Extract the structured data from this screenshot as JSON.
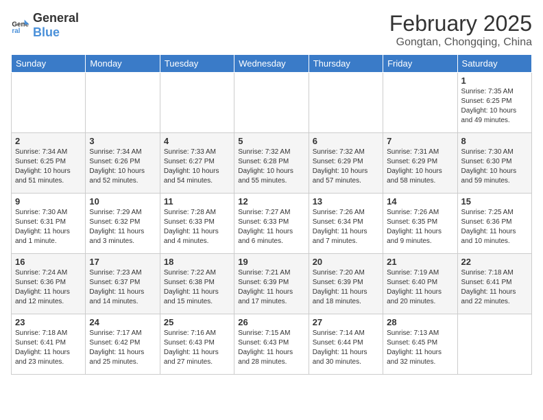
{
  "header": {
    "logo_general": "General",
    "logo_blue": "Blue",
    "month": "February 2025",
    "location": "Gongtan, Chongqing, China"
  },
  "weekdays": [
    "Sunday",
    "Monday",
    "Tuesday",
    "Wednesday",
    "Thursday",
    "Friday",
    "Saturday"
  ],
  "weeks": [
    [
      {
        "day": "",
        "info": ""
      },
      {
        "day": "",
        "info": ""
      },
      {
        "day": "",
        "info": ""
      },
      {
        "day": "",
        "info": ""
      },
      {
        "day": "",
        "info": ""
      },
      {
        "day": "",
        "info": ""
      },
      {
        "day": "1",
        "info": "Sunrise: 7:35 AM\nSunset: 6:25 PM\nDaylight: 10 hours\nand 49 minutes."
      }
    ],
    [
      {
        "day": "2",
        "info": "Sunrise: 7:34 AM\nSunset: 6:25 PM\nDaylight: 10 hours\nand 51 minutes."
      },
      {
        "day": "3",
        "info": "Sunrise: 7:34 AM\nSunset: 6:26 PM\nDaylight: 10 hours\nand 52 minutes."
      },
      {
        "day": "4",
        "info": "Sunrise: 7:33 AM\nSunset: 6:27 PM\nDaylight: 10 hours\nand 54 minutes."
      },
      {
        "day": "5",
        "info": "Sunrise: 7:32 AM\nSunset: 6:28 PM\nDaylight: 10 hours\nand 55 minutes."
      },
      {
        "day": "6",
        "info": "Sunrise: 7:32 AM\nSunset: 6:29 PM\nDaylight: 10 hours\nand 57 minutes."
      },
      {
        "day": "7",
        "info": "Sunrise: 7:31 AM\nSunset: 6:29 PM\nDaylight: 10 hours\nand 58 minutes."
      },
      {
        "day": "8",
        "info": "Sunrise: 7:30 AM\nSunset: 6:30 PM\nDaylight: 10 hours\nand 59 minutes."
      }
    ],
    [
      {
        "day": "9",
        "info": "Sunrise: 7:30 AM\nSunset: 6:31 PM\nDaylight: 11 hours\nand 1 minute."
      },
      {
        "day": "10",
        "info": "Sunrise: 7:29 AM\nSunset: 6:32 PM\nDaylight: 11 hours\nand 3 minutes."
      },
      {
        "day": "11",
        "info": "Sunrise: 7:28 AM\nSunset: 6:33 PM\nDaylight: 11 hours\nand 4 minutes."
      },
      {
        "day": "12",
        "info": "Sunrise: 7:27 AM\nSunset: 6:33 PM\nDaylight: 11 hours\nand 6 minutes."
      },
      {
        "day": "13",
        "info": "Sunrise: 7:26 AM\nSunset: 6:34 PM\nDaylight: 11 hours\nand 7 minutes."
      },
      {
        "day": "14",
        "info": "Sunrise: 7:26 AM\nSunset: 6:35 PM\nDaylight: 11 hours\nand 9 minutes."
      },
      {
        "day": "15",
        "info": "Sunrise: 7:25 AM\nSunset: 6:36 PM\nDaylight: 11 hours\nand 10 minutes."
      }
    ],
    [
      {
        "day": "16",
        "info": "Sunrise: 7:24 AM\nSunset: 6:36 PM\nDaylight: 11 hours\nand 12 minutes."
      },
      {
        "day": "17",
        "info": "Sunrise: 7:23 AM\nSunset: 6:37 PM\nDaylight: 11 hours\nand 14 minutes."
      },
      {
        "day": "18",
        "info": "Sunrise: 7:22 AM\nSunset: 6:38 PM\nDaylight: 11 hours\nand 15 minutes."
      },
      {
        "day": "19",
        "info": "Sunrise: 7:21 AM\nSunset: 6:39 PM\nDaylight: 11 hours\nand 17 minutes."
      },
      {
        "day": "20",
        "info": "Sunrise: 7:20 AM\nSunset: 6:39 PM\nDaylight: 11 hours\nand 18 minutes."
      },
      {
        "day": "21",
        "info": "Sunrise: 7:19 AM\nSunset: 6:40 PM\nDaylight: 11 hours\nand 20 minutes."
      },
      {
        "day": "22",
        "info": "Sunrise: 7:18 AM\nSunset: 6:41 PM\nDaylight: 11 hours\nand 22 minutes."
      }
    ],
    [
      {
        "day": "23",
        "info": "Sunrise: 7:18 AM\nSunset: 6:41 PM\nDaylight: 11 hours\nand 23 minutes."
      },
      {
        "day": "24",
        "info": "Sunrise: 7:17 AM\nSunset: 6:42 PM\nDaylight: 11 hours\nand 25 minutes."
      },
      {
        "day": "25",
        "info": "Sunrise: 7:16 AM\nSunset: 6:43 PM\nDaylight: 11 hours\nand 27 minutes."
      },
      {
        "day": "26",
        "info": "Sunrise: 7:15 AM\nSunset: 6:43 PM\nDaylight: 11 hours\nand 28 minutes."
      },
      {
        "day": "27",
        "info": "Sunrise: 7:14 AM\nSunset: 6:44 PM\nDaylight: 11 hours\nand 30 minutes."
      },
      {
        "day": "28",
        "info": "Sunrise: 7:13 AM\nSunset: 6:45 PM\nDaylight: 11 hours\nand 32 minutes."
      },
      {
        "day": "",
        "info": ""
      }
    ]
  ]
}
